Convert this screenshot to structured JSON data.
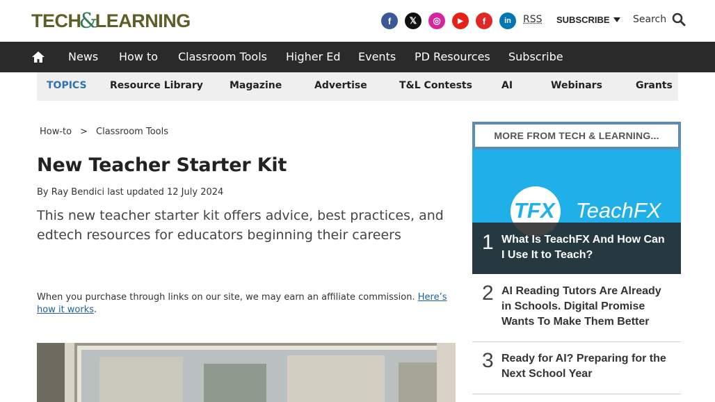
{
  "header": {
    "logo_part1": "TECH",
    "logo_amp": "&",
    "logo_part2": "LEARNING",
    "rss": "RSS",
    "subscribe": "SUBSCRIBE",
    "search": "Search",
    "social_icons": [
      "facebook-icon",
      "x-icon",
      "instagram-icon",
      "youtube-icon",
      "flipboard-icon",
      "linkedin-icon"
    ],
    "social_glyphs": [
      "f",
      "𝕏",
      "◎",
      "▶",
      "f",
      "in"
    ],
    "social_colors": [
      "#3b5998",
      "#111111",
      "#d6249f",
      "#e62117",
      "#e12828",
      "#0077b5"
    ]
  },
  "nav": {
    "items": [
      "News",
      "How to",
      "Classroom Tools",
      "Higher Ed",
      "Events",
      "PD Resources",
      "Subscribe"
    ]
  },
  "topics": {
    "label": "TOPICS",
    "items": [
      "Resource Library",
      "Magazine",
      "Advertise",
      "T&L Contests",
      "AI",
      "Webinars",
      "Grants"
    ]
  },
  "article": {
    "breadcrumb": [
      "How-to",
      ">",
      "Classroom Tools"
    ],
    "title": "New Teacher Starter Kit",
    "byline_prefix": "By",
    "author": "Ray Bendici",
    "updated": "last updated 12 July 2024",
    "standfirst": "This new teacher starter kit offers advice, best practices, and edtech resources for educators beginning their careers",
    "affiliate_text": "When you purchase through links on our site, we may earn an affiliate commission.",
    "affiliate_link": "Here’s how it works",
    "affiliate_end": "."
  },
  "sidebar": {
    "heading": "MORE FROM TECH & LEARNING...",
    "feature_logo_mark": "TFX",
    "feature_logo_text": "TeachFX",
    "items": [
      {
        "rank": "1",
        "title": "What Is TeachFX And How Can I Use It to Teach?"
      },
      {
        "rank": "2",
        "title": "AI Reading Tutors Are Already in Schools. Digital Promise Wants To Make Them Better"
      },
      {
        "rank": "3",
        "title": "Ready for AI? Preparing for the Next School Year"
      }
    ]
  },
  "colors": {
    "nav_bg": "#2a2a2a",
    "topics_bg": "#efefef",
    "topics_label": "#2e74b5",
    "sidebar_border": "#5b8bb7",
    "feature_bg": "#1fb0ea"
  }
}
